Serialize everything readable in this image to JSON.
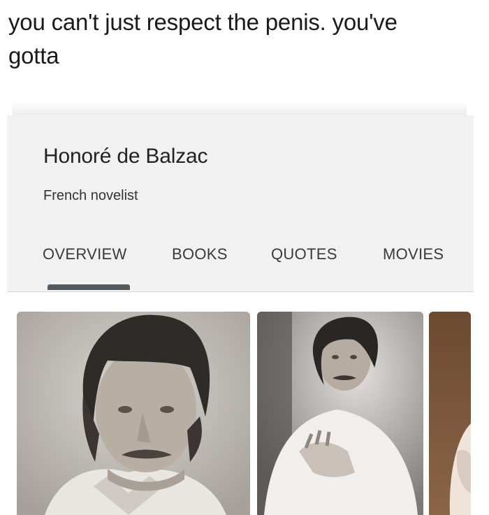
{
  "caption": {
    "line1": "you can't just respect the penis. you've",
    "line2": "gotta"
  },
  "knowledge_panel": {
    "title": "Honoré de Balzac",
    "subtitle": "French novelist",
    "tabs": [
      {
        "label": "OVERVIEW",
        "active": true
      },
      {
        "label": "BOOKS",
        "active": false
      },
      {
        "label": "QUOTES",
        "active": false
      },
      {
        "label": "MOVIES",
        "active": false
      }
    ],
    "active_tab_color": "#555a5e"
  },
  "gallery": {
    "images": [
      {
        "subject": "portrait-photo-close-up"
      },
      {
        "subject": "portrait-photo-hand-on-chest"
      },
      {
        "subject": "portrait-painting-partial"
      }
    ]
  }
}
